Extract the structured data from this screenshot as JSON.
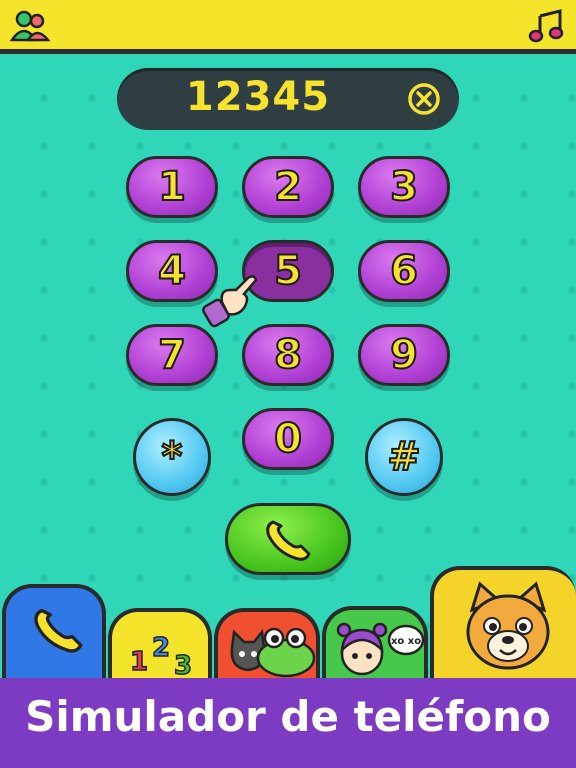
{
  "header": {
    "contacts_icon": "contacts-icon",
    "music_icon": "music-note-icon"
  },
  "display": {
    "number": "12345",
    "clear_icon": "clear-circle-x-icon"
  },
  "keypad": {
    "keys": [
      "1",
      "2",
      "3",
      "4",
      "5",
      "6",
      "7",
      "8",
      "9",
      "*",
      "0",
      "#"
    ],
    "pressed_key": "5"
  },
  "call_button": {
    "icon": "phone-icon"
  },
  "tabs": [
    {
      "name": "phone-tab",
      "icon": "phone-icon"
    },
    {
      "name": "numbers-tab",
      "icon": "numbers-icon",
      "text": "123"
    },
    {
      "name": "animals-tab",
      "icon": "animals-icon"
    },
    {
      "name": "friends-tab",
      "icon": "friends-icon",
      "text": "xo xo"
    },
    {
      "name": "puppy-tab",
      "icon": "puppy-face-icon"
    }
  ],
  "banner": {
    "title": "Simulador de teléfono"
  },
  "colors": {
    "background": "#2fd6b8",
    "topbar": "#f5e52a",
    "key_purple": "#b040d4",
    "key_blue": "#52c8f2",
    "call_green": "#44c21e",
    "banner_purple": "#7c3bc2",
    "digit_yellow": "#f7e22e"
  }
}
